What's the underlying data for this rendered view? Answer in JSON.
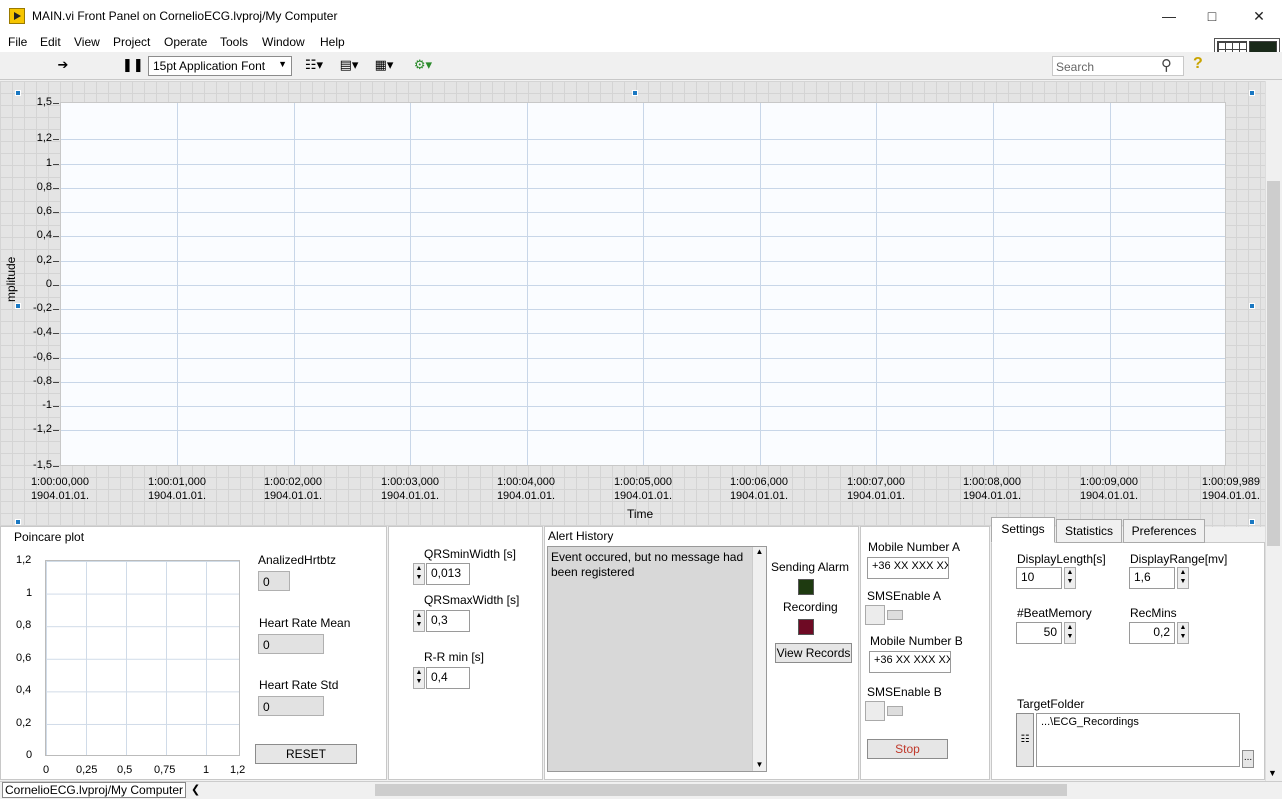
{
  "window": {
    "title": "MAIN.vi Front Panel on CornelioECG.lvproj/My Computer"
  },
  "menu": [
    "File",
    "Edit",
    "View",
    "Project",
    "Operate",
    "Tools",
    "Window",
    "Help"
  ],
  "toolbar": {
    "font": "15pt Application Font",
    "search_placeholder": "Search"
  },
  "waveform": {
    "y_label": "mplitude",
    "x_label": "Time",
    "y_ticks": [
      "1,5",
      "1,2",
      "1",
      "0,8",
      "0,6",
      "0,4",
      "0,2",
      "0",
      "-0,2",
      "-0,4",
      "-0,6",
      "-0,8",
      "-1",
      "-1,2",
      "-1,5"
    ],
    "x_ticks": [
      {
        "time": "1:00:00,000",
        "date": "1904.01.01."
      },
      {
        "time": "1:00:01,000",
        "date": "1904.01.01."
      },
      {
        "time": "1:00:02,000",
        "date": "1904.01.01."
      },
      {
        "time": "1:00:03,000",
        "date": "1904.01.01."
      },
      {
        "time": "1:00:04,000",
        "date": "1904.01.01."
      },
      {
        "time": "1:00:05,000",
        "date": "1904.01.01."
      },
      {
        "time": "1:00:06,000",
        "date": "1904.01.01."
      },
      {
        "time": "1:00:07,000",
        "date": "1904.01.01."
      },
      {
        "time": "1:00:08,000",
        "date": "1904.01.01."
      },
      {
        "time": "1:00:09,000",
        "date": "1904.01.01."
      },
      {
        "time": "1:00:09,989",
        "date": "1904.01.01."
      }
    ]
  },
  "poincare": {
    "title": "Poincare plot",
    "y_ticks": [
      "1,2",
      "1",
      "0,8",
      "0,6",
      "0,4",
      "0,2",
      "0"
    ],
    "x_ticks": [
      "0",
      "0,25",
      "0,5",
      "0,75",
      "1",
      "1,2"
    ]
  },
  "stats": {
    "analized_label": "AnalizedHrtbtz",
    "analized_value": "0",
    "mean_label": "Heart Rate Mean",
    "mean_value": "0",
    "std_label": "Heart Rate Std",
    "std_value": "0",
    "reset_label": "RESET"
  },
  "qrs": {
    "min_label": "QRSminWidth [s]",
    "min_value": "0,013",
    "max_label": "QRSmaxWidth [s]",
    "max_value": "0,3",
    "rr_label": "R-R min [s]",
    "rr_value": "0,4"
  },
  "alerts": {
    "title": "Alert History",
    "text": "Event occured, but no message had been registered",
    "sending_alarm": "Sending Alarm",
    "recording": "Recording",
    "view_records": "View Records"
  },
  "sms": {
    "mobile_a_label": "Mobile Number A",
    "mobile_a_value": "+36 XX XXX XXXX",
    "sms_a_label": "SMSEnable A",
    "mobile_b_label": "Mobile Number B",
    "mobile_b_value": "+36 XX XXX XXXX",
    "sms_b_label": "SMSEnable B",
    "stop_label": "Stop"
  },
  "settings": {
    "tabs": [
      "Settings",
      "Statistics",
      "Preferences"
    ],
    "display_length_label": "DisplayLength[s]",
    "display_length": "10",
    "display_range_label": "DisplayRange[mv]",
    "display_range": "1,6",
    "beat_memory_label": "#BeatMemory",
    "beat_memory": "50",
    "rec_mins_label": "RecMins",
    "rec_mins": "0,2",
    "target_folder_label": "TargetFolder",
    "target_folder": "...\\ECG_Recordings",
    "browse_label": "..."
  },
  "status": {
    "path": "CornelioECG.lvproj/My Computer"
  },
  "colors": {
    "sending_alarm_led": "#1e3a10",
    "recording_led": "#6e0a24"
  }
}
